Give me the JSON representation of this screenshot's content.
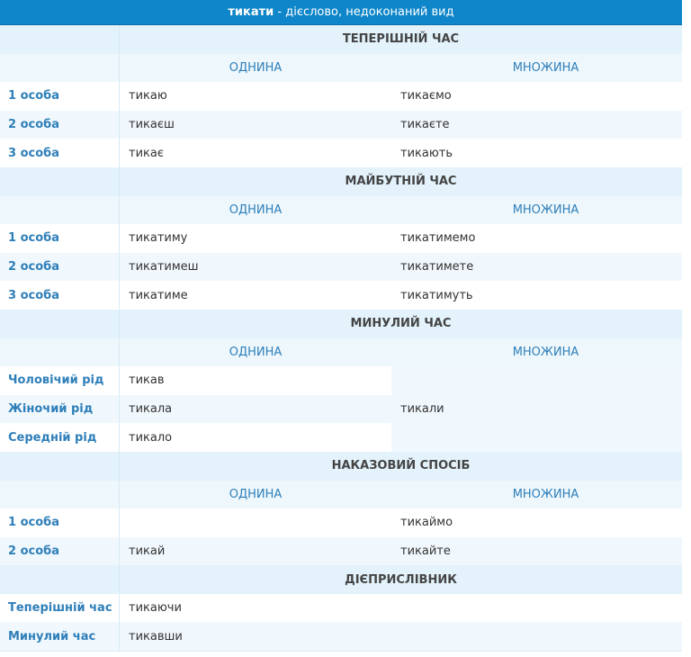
{
  "header": {
    "verb": "тикати",
    "description": " - дієслово, недоконаний вид"
  },
  "columns": {
    "singular": "ОДНИНА",
    "plural": "МНОЖИНА"
  },
  "present": {
    "title": "ТЕПЕРІШНІЙ ЧАС",
    "rows": [
      {
        "person": "1 особа",
        "singular": "тикаю",
        "plural": "тикаємо"
      },
      {
        "person": "2 особа",
        "singular": "тикаєш",
        "plural": "тикаєте"
      },
      {
        "person": "3 особа",
        "singular": "тикає",
        "plural": "тикають"
      }
    ]
  },
  "future": {
    "title": "МАЙБУТНІЙ ЧАС",
    "rows": [
      {
        "person": "1 особа",
        "singular": "тикатиму",
        "plural": "тикатимемо"
      },
      {
        "person": "2 особа",
        "singular": "тикатимеш",
        "plural": "тикатимете"
      },
      {
        "person": "3 особа",
        "singular": "тикатиме",
        "plural": "тикатимуть"
      }
    ]
  },
  "past": {
    "title": "МИНУЛИЙ ЧАС",
    "rows": [
      {
        "gender": "Чоловічий рід",
        "singular": "тикав"
      },
      {
        "gender": "Жіночий рід",
        "singular": "тикала"
      },
      {
        "gender": "Середній рід",
        "singular": "тикало"
      }
    ],
    "plural": "тикали"
  },
  "imperative": {
    "title": "НАКАЗОВИЙ СПОСІБ",
    "rows": [
      {
        "person": "1 особа",
        "singular": "",
        "plural": "тикаймо"
      },
      {
        "person": "2 особа",
        "singular": "тикай",
        "plural": "тикайте"
      }
    ]
  },
  "participle": {
    "title": "ДІЄПРИСЛІВНИК",
    "rows": [
      {
        "label": "Теперішній час",
        "value": "тикаючи"
      },
      {
        "label": "Минулий час",
        "value": "тикавши"
      }
    ]
  }
}
